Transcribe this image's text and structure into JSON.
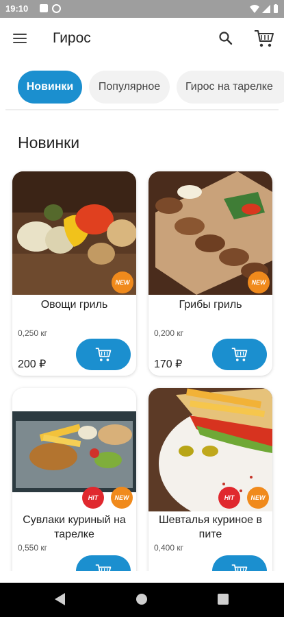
{
  "status_bar": {
    "time": "19:10"
  },
  "app_bar": {
    "title": "Гирос"
  },
  "tabs": [
    {
      "label": "Новинки",
      "active": true
    },
    {
      "label": "Популярное",
      "active": false
    },
    {
      "label": "Гирос на тарелке",
      "active": false
    }
  ],
  "section": {
    "title": "Новинки"
  },
  "products": [
    {
      "name": "Овощи гриль",
      "weight": "0,250 кг",
      "price": "200 ₽",
      "badges": [
        "NEW"
      ]
    },
    {
      "name": "Грибы гриль",
      "weight": "0,200 кг",
      "price": "170 ₽",
      "badges": [
        "NEW"
      ]
    },
    {
      "name": "Сувлаки куриный на тарелке",
      "weight": "0,550 кг",
      "price": "",
      "badges": [
        "HIT",
        "NEW"
      ]
    },
    {
      "name": "Шевталья куриное в пите",
      "weight": "0,400 кг",
      "price": "",
      "badges": [
        "HIT",
        "NEW"
      ]
    }
  ],
  "icons": {
    "menu": "menu-icon",
    "search": "search-icon",
    "cart": "cart-icon",
    "add_to_cart": "cart-icon"
  },
  "colors": {
    "accent": "#1b8fcf",
    "badge_new": "#f08a1c",
    "badge_hit": "#e0282e"
  }
}
